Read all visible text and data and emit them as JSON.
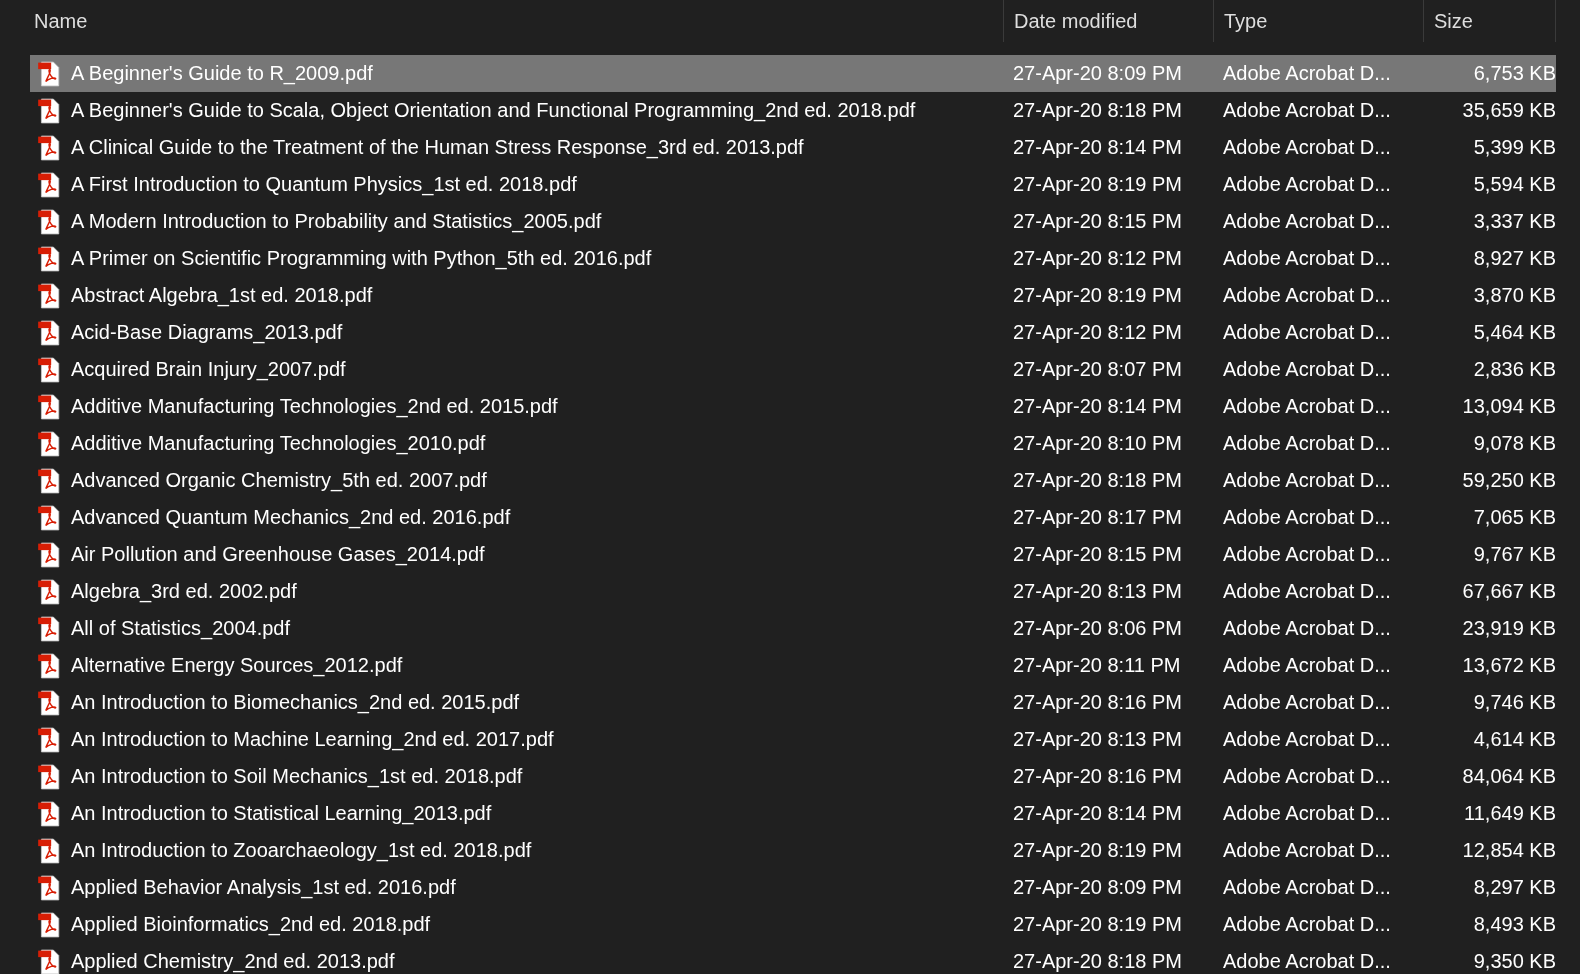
{
  "columns": [
    "Name",
    "Date modified",
    "Type",
    "Size"
  ],
  "files": [
    {
      "name": "A Beginner's Guide to R_2009.pdf",
      "date": "27-Apr-20 8:09 PM",
      "type": "Adobe Acrobat D...",
      "size": "6,753 KB",
      "selected": true
    },
    {
      "name": "A Beginner's Guide to Scala, Object Orientation and Functional Programming_2nd ed. 2018.pdf",
      "date": "27-Apr-20 8:18 PM",
      "type": "Adobe Acrobat D...",
      "size": "35,659 KB",
      "selected": false
    },
    {
      "name": "A Clinical Guide to the Treatment of the Human Stress Response_3rd ed. 2013.pdf",
      "date": "27-Apr-20 8:14 PM",
      "type": "Adobe Acrobat D...",
      "size": "5,399 KB",
      "selected": false
    },
    {
      "name": "A First Introduction to Quantum Physics_1st ed. 2018.pdf",
      "date": "27-Apr-20 8:19 PM",
      "type": "Adobe Acrobat D...",
      "size": "5,594 KB",
      "selected": false
    },
    {
      "name": "A Modern Introduction to Probability and Statistics_2005.pdf",
      "date": "27-Apr-20 8:15 PM",
      "type": "Adobe Acrobat D...",
      "size": "3,337 KB",
      "selected": false
    },
    {
      "name": "A Primer on Scientific Programming with Python_5th ed. 2016.pdf",
      "date": "27-Apr-20 8:12 PM",
      "type": "Adobe Acrobat D...",
      "size": "8,927 KB",
      "selected": false
    },
    {
      "name": "Abstract Algebra_1st ed. 2018.pdf",
      "date": "27-Apr-20 8:19 PM",
      "type": "Adobe Acrobat D...",
      "size": "3,870 KB",
      "selected": false
    },
    {
      "name": "Acid-Base Diagrams_2013.pdf",
      "date": "27-Apr-20 8:12 PM",
      "type": "Adobe Acrobat D...",
      "size": "5,464 KB",
      "selected": false
    },
    {
      "name": "Acquired Brain Injury_2007.pdf",
      "date": "27-Apr-20 8:07 PM",
      "type": "Adobe Acrobat D...",
      "size": "2,836 KB",
      "selected": false
    },
    {
      "name": "Additive Manufacturing Technologies_2nd ed. 2015.pdf",
      "date": "27-Apr-20 8:14 PM",
      "type": "Adobe Acrobat D...",
      "size": "13,094 KB",
      "selected": false
    },
    {
      "name": "Additive Manufacturing Technologies_2010.pdf",
      "date": "27-Apr-20 8:10 PM",
      "type": "Adobe Acrobat D...",
      "size": "9,078 KB",
      "selected": false
    },
    {
      "name": "Advanced Organic Chemistry_5th ed. 2007.pdf",
      "date": "27-Apr-20 8:18 PM",
      "type": "Adobe Acrobat D...",
      "size": "59,250 KB",
      "selected": false
    },
    {
      "name": "Advanced Quantum Mechanics_2nd ed. 2016.pdf",
      "date": "27-Apr-20 8:17 PM",
      "type": "Adobe Acrobat D...",
      "size": "7,065 KB",
      "selected": false
    },
    {
      "name": "Air Pollution and Greenhouse Gases_2014.pdf",
      "date": "27-Apr-20 8:15 PM",
      "type": "Adobe Acrobat D...",
      "size": "9,767 KB",
      "selected": false
    },
    {
      "name": "Algebra_3rd ed. 2002.pdf",
      "date": "27-Apr-20 8:13 PM",
      "type": "Adobe Acrobat D...",
      "size": "67,667 KB",
      "selected": false
    },
    {
      "name": "All of Statistics_2004.pdf",
      "date": "27-Apr-20 8:06 PM",
      "type": "Adobe Acrobat D...",
      "size": "23,919 KB",
      "selected": false
    },
    {
      "name": "Alternative Energy Sources_2012.pdf",
      "date": "27-Apr-20 8:11 PM",
      "type": "Adobe Acrobat D...",
      "size": "13,672 KB",
      "selected": false
    },
    {
      "name": "An Introduction to Biomechanics_2nd ed. 2015.pdf",
      "date": "27-Apr-20 8:16 PM",
      "type": "Adobe Acrobat D...",
      "size": "9,746 KB",
      "selected": false
    },
    {
      "name": "An Introduction to Machine Learning_2nd ed. 2017.pdf",
      "date": "27-Apr-20 8:13 PM",
      "type": "Adobe Acrobat D...",
      "size": "4,614 KB",
      "selected": false
    },
    {
      "name": "An Introduction to Soil Mechanics_1st ed. 2018.pdf",
      "date": "27-Apr-20 8:16 PM",
      "type": "Adobe Acrobat D...",
      "size": "84,064 KB",
      "selected": false
    },
    {
      "name": "An Introduction to Statistical Learning_2013.pdf",
      "date": "27-Apr-20 8:14 PM",
      "type": "Adobe Acrobat D...",
      "size": "11,649 KB",
      "selected": false
    },
    {
      "name": "An Introduction to Zooarchaeology_1st ed. 2018.pdf",
      "date": "27-Apr-20 8:19 PM",
      "type": "Adobe Acrobat D...",
      "size": "12,854 KB",
      "selected": false
    },
    {
      "name": "Applied Behavior Analysis_1st ed. 2016.pdf",
      "date": "27-Apr-20 8:09 PM",
      "type": "Adobe Acrobat D...",
      "size": "8,297 KB",
      "selected": false
    },
    {
      "name": "Applied Bioinformatics_2nd ed. 2018.pdf",
      "date": "27-Apr-20 8:19 PM",
      "type": "Adobe Acrobat D...",
      "size": "8,493 KB",
      "selected": false
    },
    {
      "name": "Applied Chemistry_2nd ed. 2013.pdf",
      "date": "27-Apr-20 8:18 PM",
      "type": "Adobe Acrobat D...",
      "size": "9,350 KB",
      "selected": false
    }
  ]
}
